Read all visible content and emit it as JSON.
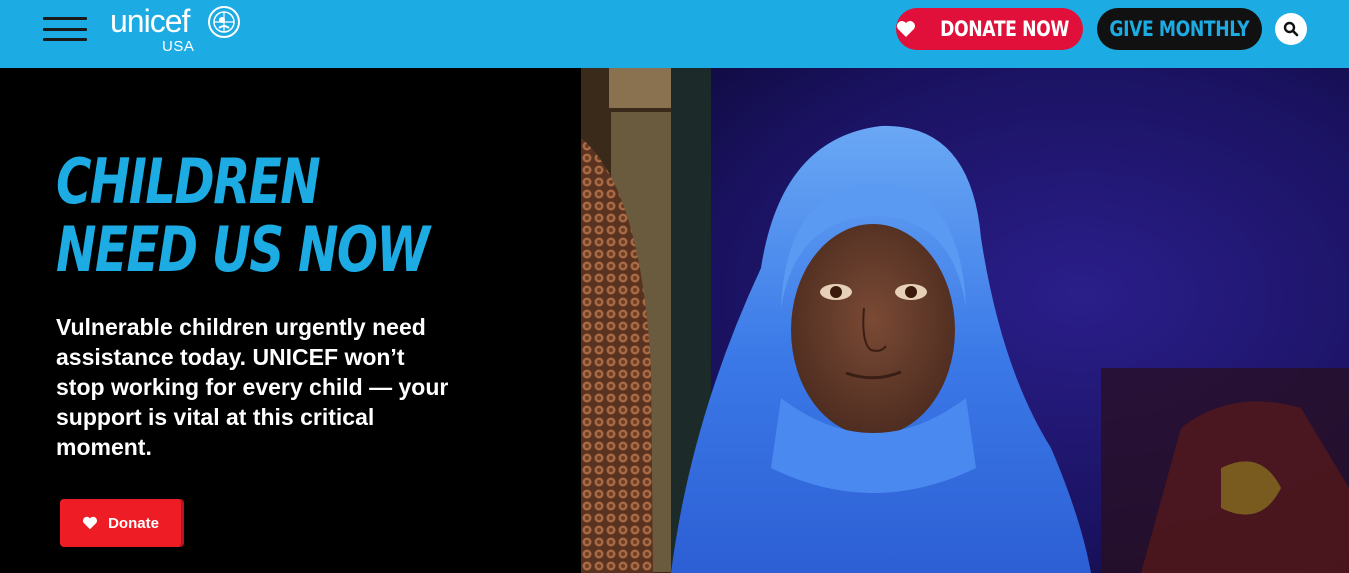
{
  "header": {
    "menu_icon": "hamburger-menu-icon",
    "logo": {
      "word": "unicef",
      "sub": "USA",
      "emblem_icon": "unicef-emblem-icon"
    },
    "donate_now_label": "DONATE NOW",
    "give_monthly_label": "GIVE MONTHLY",
    "search_icon": "search-icon"
  },
  "hero": {
    "headline_line1": "CHILDREN",
    "headline_line2": "NEED US NOW",
    "body": "Vulnerable children urgently need assistance today. UNICEF won’t stop working for every child — your support is vital at this critical moment.",
    "donate_label": "Donate",
    "heart_icon": "heart-icon"
  },
  "colors": {
    "brand_blue": "#1cabe2",
    "donate_red": "#e0103a",
    "button_red": "#ee1c24",
    "dark": "#111111"
  }
}
